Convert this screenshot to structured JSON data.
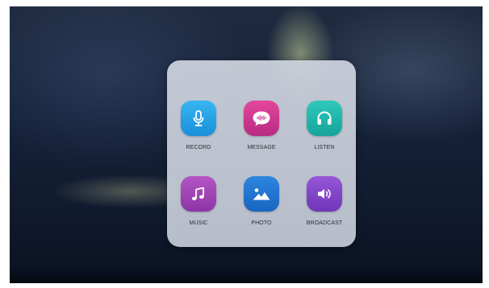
{
  "launcher": {
    "apps": [
      {
        "id": "record",
        "label": "RECORD",
        "icon": "microphone-icon",
        "color": "#1a8fdc"
      },
      {
        "id": "message",
        "label": "MESSAGE",
        "icon": "chat-bubble-icon",
        "color": "#c8338c"
      },
      {
        "id": "listen",
        "label": "LISTEN",
        "icon": "headphones-icon",
        "color": "#1db5aa"
      },
      {
        "id": "music",
        "label": "MUSIC",
        "icon": "music-note-icon",
        "color": "#9e44b4"
      },
      {
        "id": "photo",
        "label": "PHOTO",
        "icon": "image-icon",
        "color": "#1e74d0"
      },
      {
        "id": "broadcast",
        "label": "BROADCAST",
        "icon": "speaker-icon",
        "color": "#8144c8"
      }
    ]
  }
}
